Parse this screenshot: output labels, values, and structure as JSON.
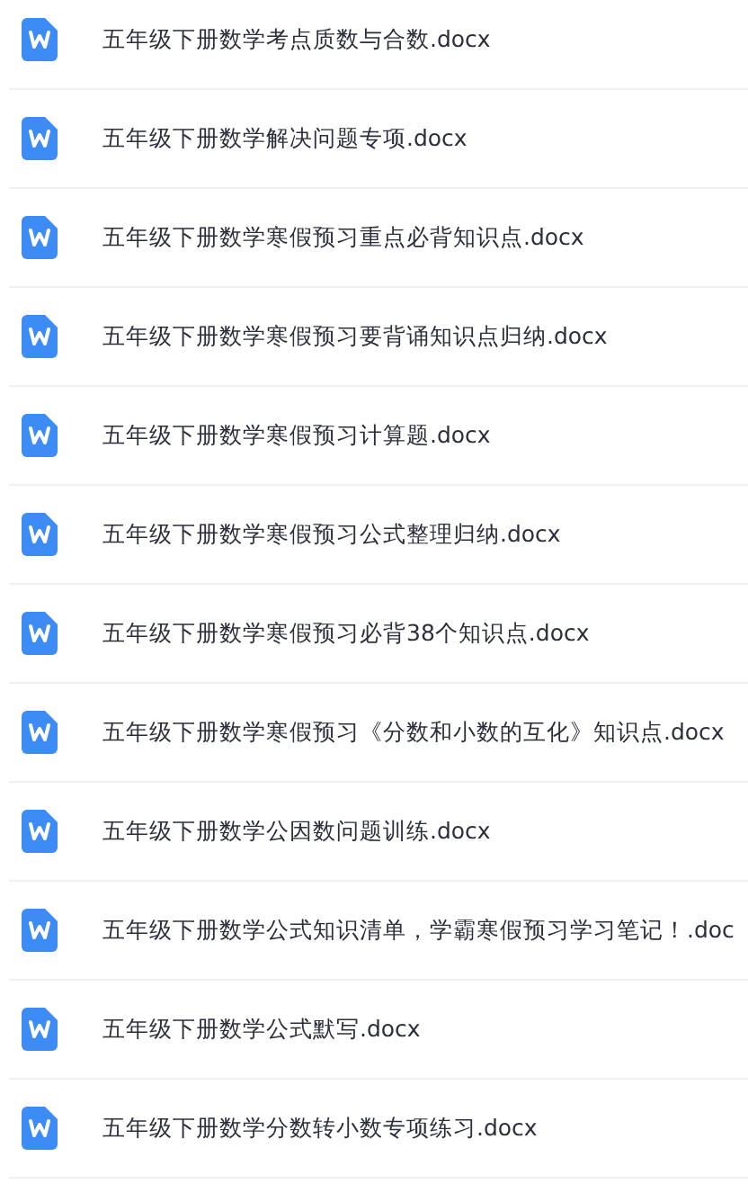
{
  "files": [
    {
      "name": "五年级下册数学考点质数与合数.docx"
    },
    {
      "name": "五年级下册数学解决问题专项.docx"
    },
    {
      "name": "五年级下册数学寒假预习重点必背知识点.docx"
    },
    {
      "name": "五年级下册数学寒假预习要背诵知识点归纳.docx"
    },
    {
      "name": "五年级下册数学寒假预习计算题.docx"
    },
    {
      "name": "五年级下册数学寒假预习公式整理归纳.docx"
    },
    {
      "name": "五年级下册数学寒假预习必背38个知识点.docx"
    },
    {
      "name": "五年级下册数学寒假预习《分数和小数的互化》知识点.docx"
    },
    {
      "name": "五年级下册数学公因数问题训练.docx"
    },
    {
      "name": "五年级下册数学公式知识清单，学霸寒假预习学习笔记！.doc"
    },
    {
      "name": "五年级下册数学公式默写.docx"
    },
    {
      "name": "五年级下册数学分数转小数专项练习.docx"
    }
  ]
}
